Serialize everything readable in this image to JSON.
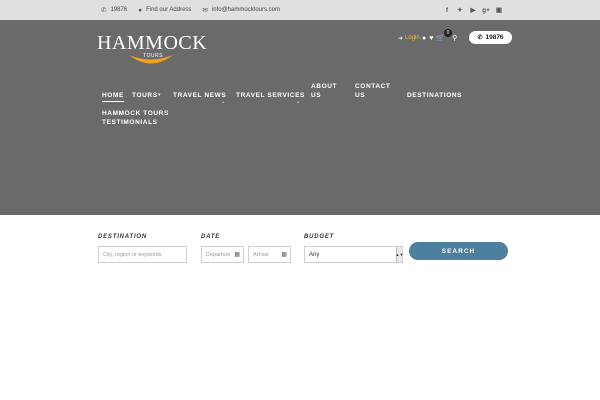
{
  "topbar": {
    "phone": "19876",
    "address": "Find our Address",
    "email": "info@hammocktours.com",
    "social_icons": [
      "facebook-icon",
      "twitter-icon",
      "youtube-icon",
      "google-plus-icon",
      "instagram-icon"
    ]
  },
  "header": {
    "logo_text": "HAMMOCK",
    "logo_sub": "TOURS",
    "login": "Login",
    "cart_count": "0",
    "phone_button": "19876"
  },
  "nav": {
    "home": "HOME",
    "tours": "TOURS",
    "travel_news": "TRAVEL NEWS",
    "travel_services": "TRAVEL SERVICES",
    "about_l1": "ABOUT",
    "about_l2": "US",
    "contact_l1": "CONTACT",
    "contact_l2": "US",
    "destinations": "DESTINATIONS",
    "hammock_tours": "HAMMOCK TOURS",
    "testimonials": "TESTIMONIALS"
  },
  "search": {
    "destination_label": "DESTINATION",
    "destination_placeholder": "City, region or keywords",
    "date_label": "DATE",
    "departure_placeholder": "Departure",
    "arrival_placeholder": "Arrival",
    "budget_label": "BUDGET",
    "budget_value": "Any",
    "button": "SEARCH"
  },
  "colors": {
    "topbar": "#e0e0e0",
    "hero": "#6a6a6a",
    "accent": "#4d7f9e",
    "login": "#f0c040",
    "logo_swoosh": "#f2a21b"
  }
}
